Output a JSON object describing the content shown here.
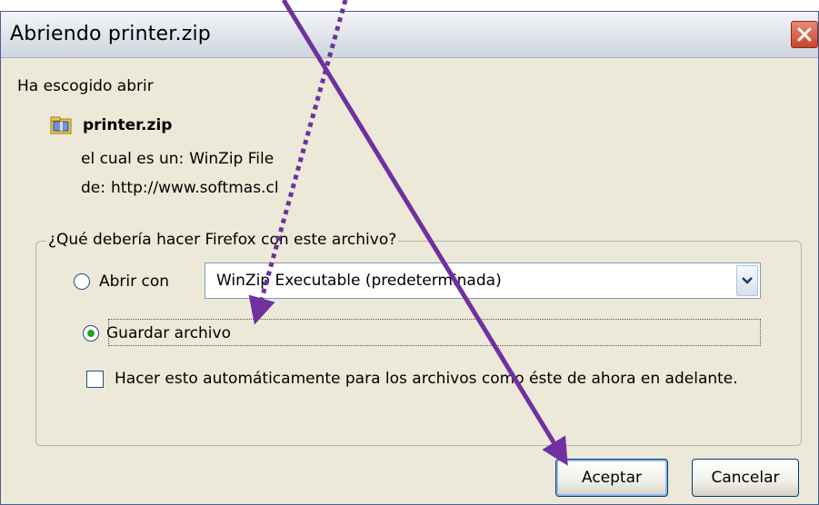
{
  "dialog": {
    "title": "Abriendo printer.zip",
    "chosen_text": "Ha escogido abrir",
    "file_name": "printer.zip",
    "type_label": "el cual es un:",
    "type_value": "WinZip File",
    "from_label": "de:",
    "from_value": "http://www.softmas.cl",
    "group_legend": "¿Qué debería hacer Firefox con este archivo?",
    "open_with_label": "Abrir con",
    "open_with_app": "WinZip Executable (predeterminada)",
    "save_label": "Guardar archivo",
    "auto_label": "Hacer esto automáticamente para los archivos como éste de ahora en adelante.",
    "ok_label": "Aceptar",
    "cancel_label": "Cancelar"
  },
  "state": {
    "selected_option": "Guardar archivo",
    "auto_checked": false
  },
  "icons": {
    "file": "zip-file-icon",
    "close": "close-icon",
    "dropdown": "chevron-down-icon"
  },
  "colors": {
    "annotation_arrow": "#7030a0",
    "close_button": "#d0533a"
  }
}
